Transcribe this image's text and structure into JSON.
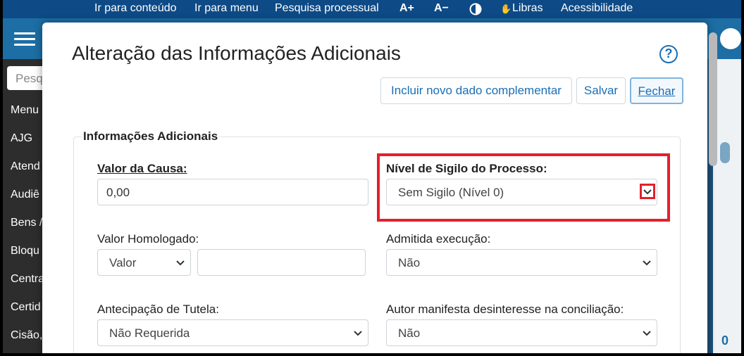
{
  "topbar": {
    "items": [
      "Ir para conteúdo",
      "Ir para menu",
      "Pesquisa processual",
      "A+",
      "A−",
      "Libras",
      "Acessibilidade"
    ]
  },
  "sidebar": {
    "search_placeholder": "Pesq",
    "items": [
      "Menu",
      "AJG",
      "Atend",
      "Audiê",
      "Bens /",
      "Bloqu",
      "Centra",
      "Certid",
      "Cisão,"
    ]
  },
  "background": {
    "right_number": "0"
  },
  "modal": {
    "title": "Alteração das Informações Adicionais",
    "help_label": "?",
    "buttons": {
      "add": "Incluir novo dado complementar",
      "save": "Salvar",
      "close": "Fechar"
    },
    "section_title": "Informações Adicionais",
    "fields": {
      "valor_causa": {
        "label": "Valor da Causa:",
        "value": "0,00"
      },
      "nivel_sigilo": {
        "label": "Nível de Sigilo do Processo:",
        "value": "Sem Sigilo (Nível 0)"
      },
      "valor_homologado": {
        "label": "Valor Homologado:",
        "select_value": "Valor",
        "value": ""
      },
      "admitida_execucao": {
        "label": "Admitida execução:",
        "value": "Não"
      },
      "antecipacao_tutela": {
        "label": "Antecipação de Tutela:",
        "value": "Não Requerida"
      },
      "autor_desinteresse": {
        "label": "Autor manifesta desinteresse na conciliação:",
        "value": "Não"
      }
    }
  },
  "colors": {
    "topbar": "#0d4a86",
    "accent": "#1a6fb5",
    "highlight": "#e3202d"
  }
}
